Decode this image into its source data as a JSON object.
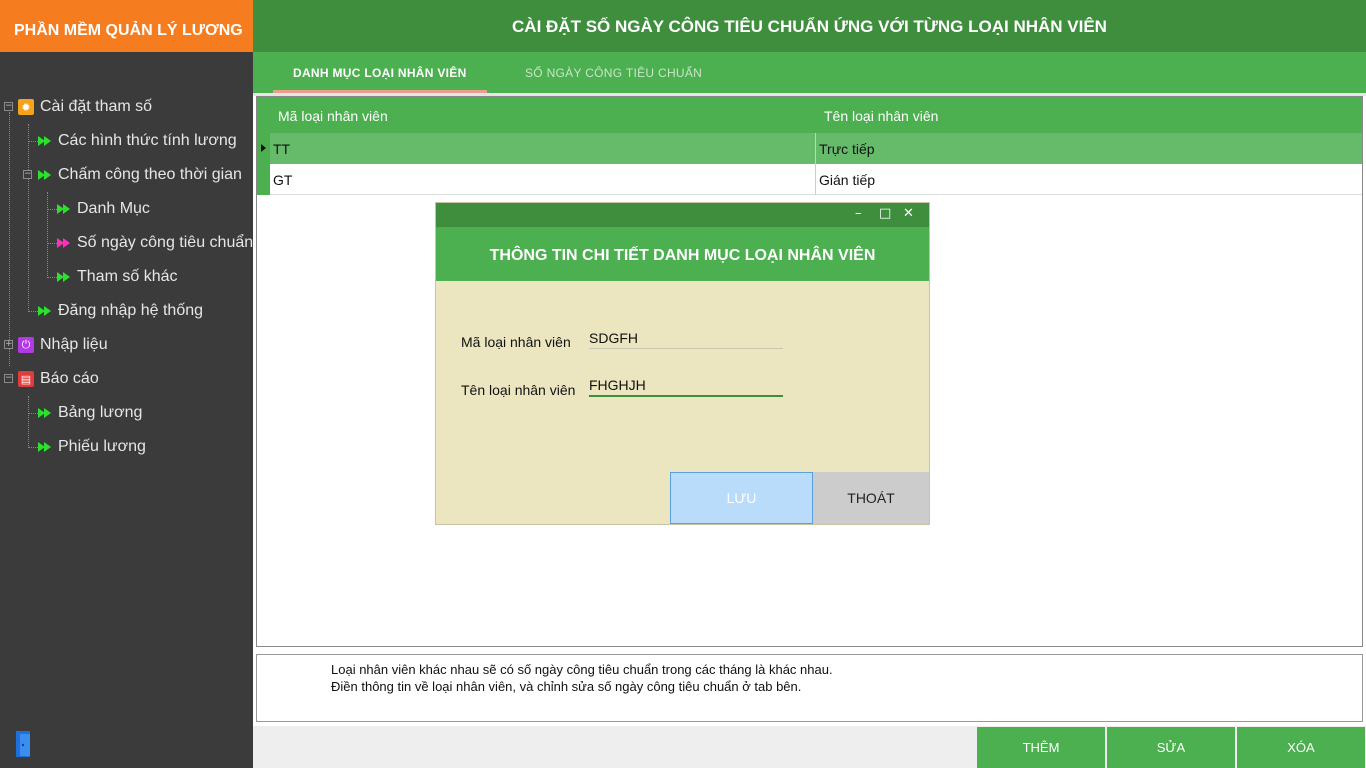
{
  "app": {
    "title": "PHẦN MỀM QUẢN LÝ LƯƠNG"
  },
  "header": {
    "title": "CÀI ĐẶT SỐ NGÀY CÔNG TIÊU CHUẨN ỨNG VỚI TỪNG LOẠI NHÂN VIÊN"
  },
  "tabs": [
    {
      "label": "DANH MỤC LOẠI NHÂN VIÊN",
      "active": true
    },
    {
      "label": "SỐ NGÀY CÔNG TIÊU CHUẨN",
      "active": false
    }
  ],
  "sidebar": {
    "items": [
      {
        "label": "Cài đặt tham số",
        "icon": "gear-icon",
        "expanded": true
      },
      {
        "label": "Các hình thức tính lương",
        "icon": "double-arrow-icon"
      },
      {
        "label": "Chấm công theo thời gian",
        "icon": "double-arrow-icon",
        "expanded": true
      },
      {
        "label": "Danh Mục",
        "icon": "double-arrow-icon"
      },
      {
        "label": "Số ngày công tiêu chuẩn",
        "icon": "double-arrow-icon",
        "selected": true
      },
      {
        "label": "Tham số khác",
        "icon": "double-arrow-icon"
      },
      {
        "label": "Đăng nhập hệ thống",
        "icon": "double-arrow-icon"
      },
      {
        "label": "Nhập liệu",
        "icon": "power-icon",
        "expanded": false
      },
      {
        "label": "Báo cáo",
        "icon": "report-icon",
        "expanded": true
      },
      {
        "label": "Bảng lương",
        "icon": "double-arrow-icon"
      },
      {
        "label": "Phiếu lương",
        "icon": "double-arrow-icon"
      }
    ]
  },
  "grid": {
    "columns": [
      "Mã loại nhân viên",
      "Tên loại nhân viên"
    ],
    "rows": [
      {
        "code": "TT",
        "name": "Trực tiếp",
        "selected": true
      },
      {
        "code": "GT",
        "name": "Gián tiếp",
        "selected": false
      }
    ]
  },
  "dialog": {
    "title": "THÔNG TIN CHI TIẾT DANH MỤC LOẠI NHÂN VIÊN",
    "minimize": "–",
    "maximize": "□",
    "close": "✕",
    "code_label": "Mã loại nhân viên",
    "code_value": "SDGFH",
    "name_label": "Tên loại nhân viên",
    "name_value": "FHGHJH",
    "save_label": "LƯU",
    "exit_label": "THOÁT"
  },
  "notes": {
    "line1": "Loại nhân viên khác nhau sẽ có số ngày công tiêu chuẩn trong các tháng là  khác nhau.",
    "line2": "Điền thông tin về loại nhân viên, và chỉnh sửa số ngày công tiêu chuẩn ở tab bên."
  },
  "actions": {
    "add": "THÊM",
    "edit": "SỬA",
    "delete": "XÓA"
  },
  "colors": {
    "brand_orange": "#f57c1f",
    "header_green": "#3e8e3e",
    "accent_green": "#4caf50",
    "selected_row": "#66bb6a",
    "sidebar_bg": "#3b3b3b",
    "dialog_bg": "#ebe6c0"
  }
}
